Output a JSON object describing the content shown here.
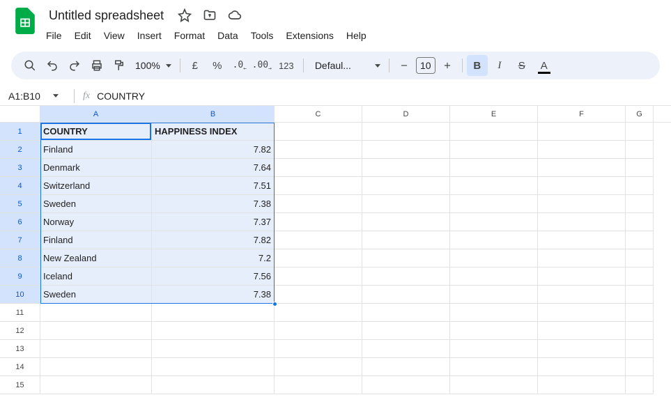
{
  "doc": {
    "title": "Untitled spreadsheet"
  },
  "menu": {
    "items": [
      "File",
      "Edit",
      "View",
      "Insert",
      "Format",
      "Data",
      "Tools",
      "Extensions",
      "Help"
    ]
  },
  "toolbar": {
    "zoom": "100%",
    "currency_symbol": "£",
    "percent_symbol": "%",
    "format_123": "123",
    "font": "Defaul...",
    "font_size": "10"
  },
  "name_box": "A1:B10",
  "formula": "COUNTRY",
  "columns": [
    "A",
    "B",
    "C",
    "D",
    "E",
    "F",
    "G"
  ],
  "sheet": {
    "headers": {
      "A": "COUNTRY",
      "B": "HAPPINESS INDEX"
    },
    "rows": [
      {
        "A": "Finland",
        "B": "7.82"
      },
      {
        "A": "Denmark",
        "B": "7.64"
      },
      {
        "A": "Switzerland",
        "B": "7.51"
      },
      {
        "A": "Sweden",
        "B": "7.38"
      },
      {
        "A": "Norway",
        "B": "7.37"
      },
      {
        "A": "Finland",
        "B": "7.82"
      },
      {
        "A": "New Zealand",
        "B": "7.2"
      },
      {
        "A": "Iceland",
        "B": "7.56"
      },
      {
        "A": "Sweden",
        "B": "7.38"
      }
    ]
  },
  "selection": {
    "range": "A1:B10"
  },
  "empty_rows": 5
}
